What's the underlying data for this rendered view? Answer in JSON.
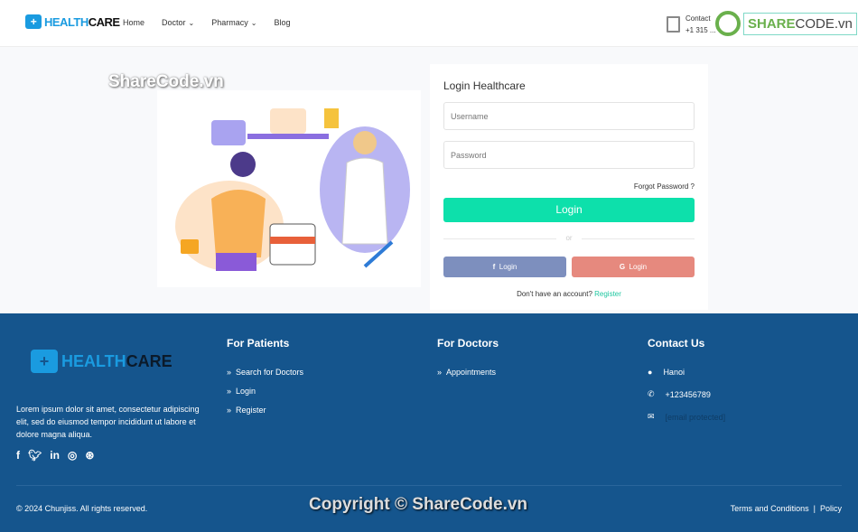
{
  "header": {
    "logo_h": "HEALTH",
    "logo_c": "CARE",
    "nav": [
      {
        "label": "Home"
      },
      {
        "label": "Doctor",
        "dropdown": true
      },
      {
        "label": "Pharmacy",
        "dropdown": true
      },
      {
        "label": "Blog"
      }
    ],
    "contact_label": "Contact",
    "contact_phone": "+1 315 ..."
  },
  "watermark": {
    "logo_a": "SHARE",
    "logo_b": "CODE",
    "logo_c": ".vn",
    "text": "ShareCode.vn",
    "copyright": "Copyright © ShareCode.vn"
  },
  "login": {
    "title": "Login Healthcare",
    "username_placeholder": "Username",
    "password_placeholder": "Password",
    "forgot": "Forgot Password ?",
    "login_button": "Login",
    "or": "or",
    "facebook_label": "Login",
    "google_label": "Login",
    "no_account": "Don't have an account?",
    "register": "Register",
    "colors": {
      "primary": "#0de0ab",
      "facebook": "#7d8fbe",
      "google": "#e6897e"
    }
  },
  "footer": {
    "logo_h": "HEALTH",
    "logo_c": "CARE",
    "description": "Lorem ipsum dolor sit amet, consectetur adipiscing elit, sed do eiusmod tempor incididunt ut labore et dolore magna aliqua.",
    "patients": {
      "title": "For Patients",
      "links": [
        "Search for Doctors",
        "Login",
        "Register"
      ]
    },
    "doctors": {
      "title": "For Doctors",
      "links": [
        "Appointments"
      ]
    },
    "contact": {
      "title": "Contact Us",
      "address": "Hanoi",
      "phone": "+123456789",
      "email": "[email protected]"
    },
    "copyright": "© 2024 Chunjiss. All rights reserved.",
    "terms": "Terms and Conditions",
    "sep": "|",
    "policy": "Policy",
    "bg": "#15558d"
  }
}
